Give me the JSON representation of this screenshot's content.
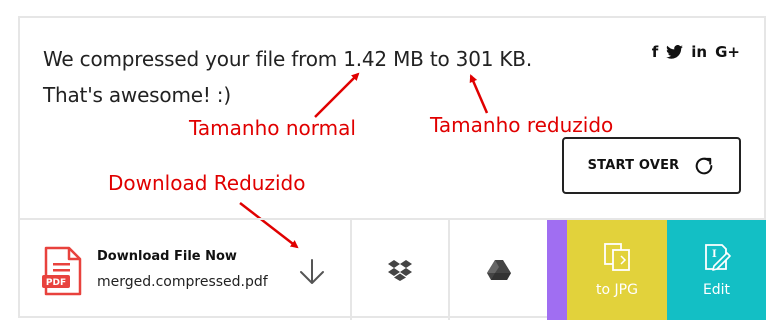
{
  "result": {
    "line1": "We compressed your file from 1.42 MB to 301 KB.",
    "line2": "That's awesome! :)"
  },
  "social": {
    "icons": [
      "facebook-icon",
      "twitter-icon",
      "linkedin-icon",
      "google-plus-icon"
    ],
    "facebook": "f",
    "linkedin": "in",
    "google": "G+"
  },
  "annotations": {
    "normal": "Tamanho normal",
    "reduced": "Tamanho reduzido",
    "download": "Download Reduzido",
    "color": "#e00000"
  },
  "start_over": {
    "label": "START OVER",
    "icon": "refresh-icon"
  },
  "download": {
    "title": "Download File Now",
    "filename": "merged.compressed.pdf",
    "pdf_badge": "PDF",
    "icon": "download-arrow-icon"
  },
  "cloud": {
    "dropbox_icon": "dropbox-icon",
    "drive_icon": "google-drive-icon"
  },
  "tools": {
    "to_jpg": {
      "label": "to JPG",
      "color": "#e2d23b",
      "icon": "image-convert-icon"
    },
    "edit": {
      "label": "Edit",
      "color": "#13bfc5",
      "icon": "edit-icon"
    },
    "strip_color": "#a06ef2"
  }
}
